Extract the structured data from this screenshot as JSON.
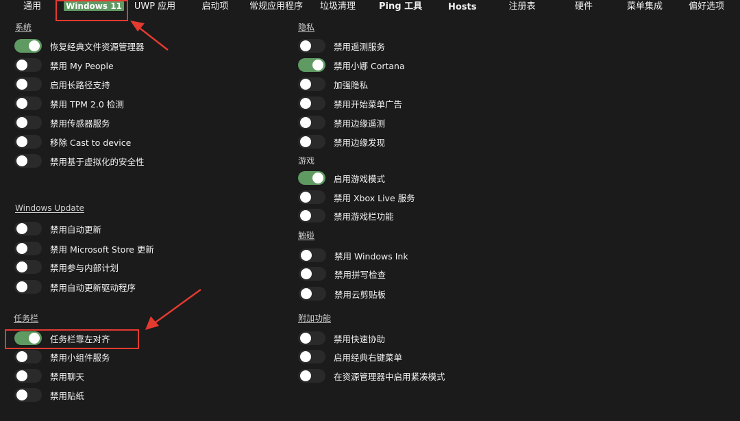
{
  "tabs": [
    {
      "label": "通用",
      "active": false
    },
    {
      "label": "Windows 11",
      "active": true
    },
    {
      "label": "UWP 应用",
      "active": false
    },
    {
      "label": "启动项",
      "active": false
    },
    {
      "label": "常规应用程序",
      "active": false
    },
    {
      "label": "垃圾清理",
      "active": false
    },
    {
      "label": "Ping 工具",
      "active": false
    },
    {
      "label": "Hosts",
      "active": false
    },
    {
      "label": "注册表",
      "active": false
    },
    {
      "label": "硬件",
      "active": false
    },
    {
      "label": "菜单集成",
      "active": false
    },
    {
      "label": "偏好选项",
      "active": false
    }
  ],
  "sections": {
    "system": {
      "title": "系统",
      "items": [
        {
          "label": "恢复经典文件资源管理器",
          "on": true
        },
        {
          "label": "禁用 My People",
          "on": false
        },
        {
          "label": "启用长路径支持",
          "on": false
        },
        {
          "label": "禁用 TPM 2.0 检测",
          "on": false
        },
        {
          "label": "禁用传感器服务",
          "on": false
        },
        {
          "label": "移除 Cast to device",
          "on": false
        },
        {
          "label": "禁用基于虚拟化的安全性",
          "on": false
        }
      ]
    },
    "windows_update": {
      "title": "Windows Update",
      "items": [
        {
          "label": "禁用自动更新",
          "on": false
        },
        {
          "label": "禁用 Microsoft Store 更新",
          "on": false
        },
        {
          "label": "禁用参与内部计划",
          "on": false
        },
        {
          "label": "禁用自动更新驱动程序",
          "on": false
        }
      ]
    },
    "taskbar": {
      "title": "任务栏",
      "items": [
        {
          "label": "任务栏靠左对齐",
          "on": true
        },
        {
          "label": "禁用小组件服务",
          "on": false
        },
        {
          "label": "禁用聊天",
          "on": false
        },
        {
          "label": "禁用贴纸",
          "on": false
        }
      ]
    },
    "privacy": {
      "title": "隐私",
      "items": [
        {
          "label": "禁用遥测服务",
          "on": false
        },
        {
          "label": "禁用小娜 Cortana",
          "on": true
        },
        {
          "label": "加强隐私",
          "on": false
        },
        {
          "label": "禁用开始菜单广告",
          "on": false
        },
        {
          "label": "禁用边缘遥测",
          "on": false
        },
        {
          "label": "禁用边缘发现",
          "on": false
        }
      ]
    },
    "gaming": {
      "title": "游戏",
      "items": [
        {
          "label": "启用游戏模式",
          "on": true
        },
        {
          "label": "禁用 Xbox Live 服务",
          "on": false
        },
        {
          "label": "禁用游戏栏功能",
          "on": false
        }
      ]
    },
    "touch": {
      "title": "触碰",
      "items": [
        {
          "label": "禁用 Windows Ink",
          "on": false
        },
        {
          "label": "禁用拼写检查",
          "on": false
        },
        {
          "label": "禁用云剪贴板",
          "on": false
        }
      ]
    },
    "extras": {
      "title": "附加功能",
      "items": [
        {
          "label": "禁用快速协助",
          "on": false
        },
        {
          "label": "启用经典右键菜单",
          "on": false
        },
        {
          "label": "在资源管理器中启用紧凑模式",
          "on": false
        }
      ]
    }
  },
  "colors": {
    "toggle_on": "#5f9a63",
    "toggle_off": "#2a2a2a",
    "highlight": "#e53a30"
  }
}
